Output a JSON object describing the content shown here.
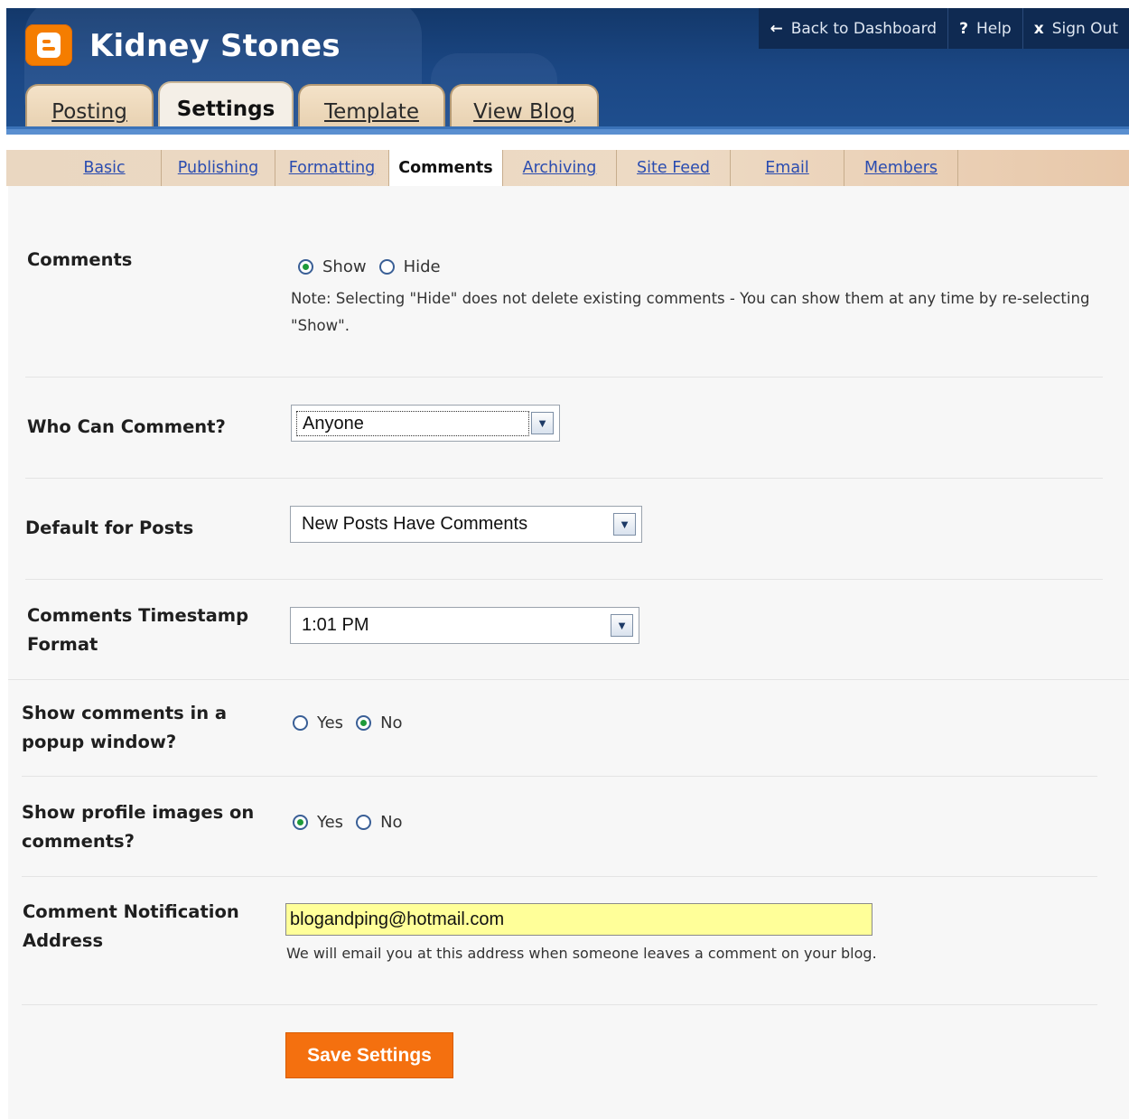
{
  "blog": {
    "title": "Kidney Stones"
  },
  "top_links": {
    "back": {
      "icon": "←",
      "label": "Back to Dashboard"
    },
    "help": {
      "icon": "?",
      "label": "Help"
    },
    "signout": {
      "icon": "x",
      "label": "Sign Out"
    }
  },
  "main_tabs": [
    "Posting",
    "Settings",
    "Template",
    "View Blog"
  ],
  "sub_tabs": [
    "Basic",
    "Publishing",
    "Formatting",
    "Comments",
    "Archiving",
    "Site Feed",
    "Email",
    "Members"
  ],
  "form": {
    "comments": {
      "label": "Comments",
      "option_show": "Show",
      "option_hide": "Hide",
      "selected": "Show",
      "note_line1": "Note: Selecting \"Hide\" does not delete existing comments - You can show them at any time by re-selecting",
      "note_line2": "\"Show\"."
    },
    "who_can_comment": {
      "label": "Who Can Comment?",
      "value": "Anyone"
    },
    "default_for_posts": {
      "label": "Default for Posts",
      "value": "New Posts Have Comments"
    },
    "timestamp_format": {
      "label_line1": "Comments Timestamp",
      "label_line2": "Format",
      "value": "1:01 PM"
    },
    "popup_window": {
      "label_line1": "Show comments in a",
      "label_line2": "popup window?",
      "option_yes": "Yes",
      "option_no": "No",
      "selected": "No"
    },
    "profile_images": {
      "label_line1": "Show profile images on",
      "label_line2": "comments?",
      "option_yes": "Yes",
      "option_no": "No",
      "selected": "Yes"
    },
    "notification": {
      "label_line1": "Comment Notification",
      "label_line2": "Address",
      "value": "blogandping@hotmail.com",
      "help": "We will email you at this address when someone leaves a comment on your blog."
    },
    "save_label": "Save Settings"
  },
  "colors": {
    "accent_orange": "#f4700f",
    "header_blue": "#1b4784",
    "link_blue": "#2a4cb0"
  }
}
